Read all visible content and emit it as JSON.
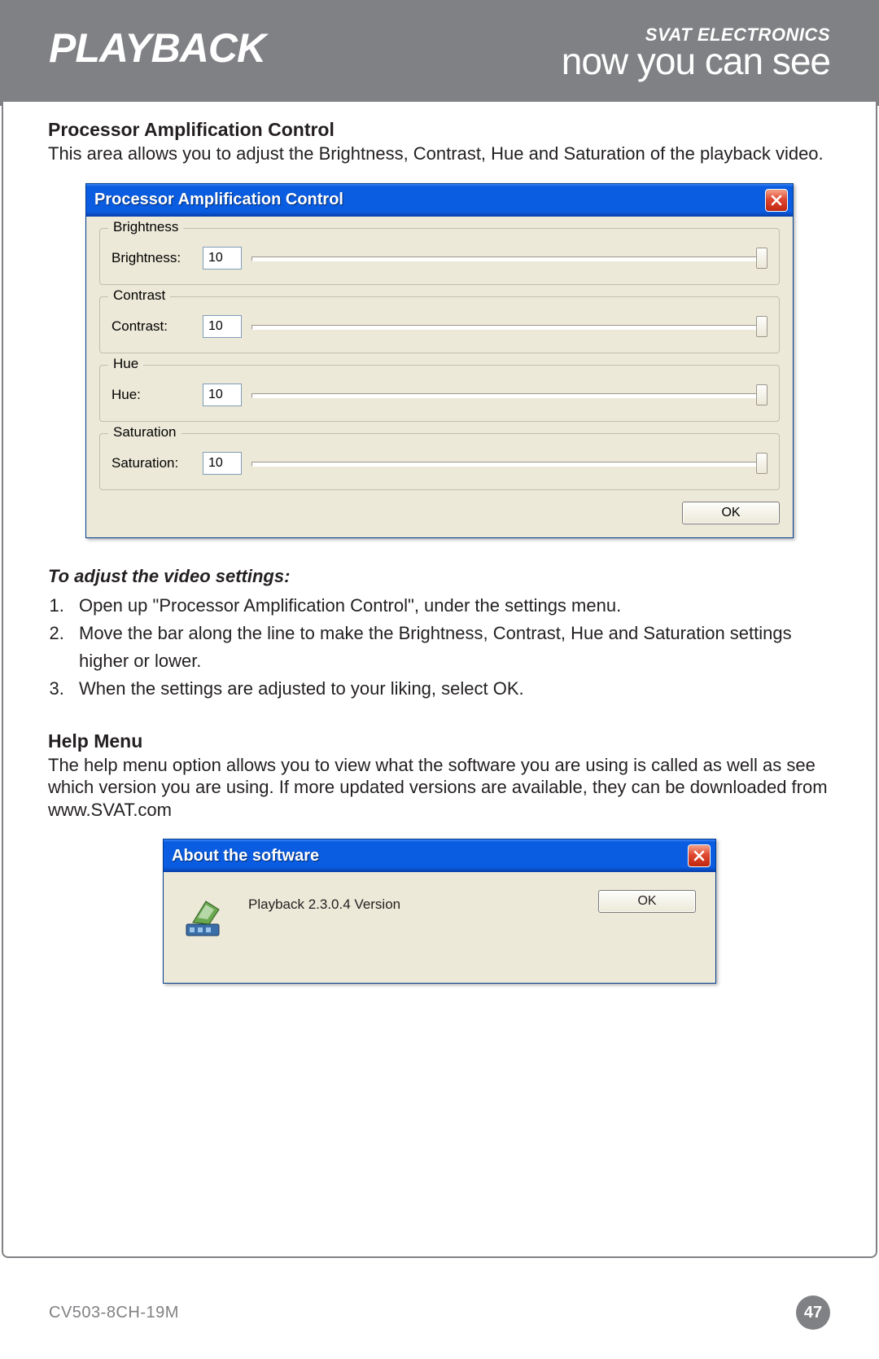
{
  "header": {
    "title": "PLAYBACK",
    "brand_small": "SVAT ELECTRONICS",
    "brand_big": "now you can see"
  },
  "section1": {
    "heading": "Processor Amplification Control",
    "text": "This area allows you to adjust the Brightness, Contrast, Hue and Saturation of the playback video."
  },
  "dialog": {
    "title": "Processor Amplification Control",
    "brightness": {
      "legend": "Brightness",
      "label": "Brightness:",
      "value": "10"
    },
    "contrast": {
      "legend": "Contrast",
      "label": "Contrast:",
      "value": "10"
    },
    "hue": {
      "legend": "Hue",
      "label": "Hue:",
      "value": "10"
    },
    "saturation": {
      "legend": "Saturation",
      "label": "Saturation:",
      "value": "10"
    },
    "ok": "OK"
  },
  "steps": {
    "heading": "To adjust the video settings:",
    "items": [
      "Open up \"Processor Amplification Control\", under the settings menu.",
      "Move the bar along the line to make the Brightness, Contrast, Hue and Saturation settings higher or lower.",
      "When the settings are adjusted to your liking, select OK."
    ]
  },
  "help": {
    "heading": "Help Menu",
    "text": "The help menu option allows you to view what the software you are using is called as well as see which version you are using. If more updated versions are available, they can be downloaded from www.SVAT.com"
  },
  "about": {
    "title": "About the software",
    "text": "Playback 2.3.0.4 Version",
    "ok": "OK"
  },
  "footer": {
    "model": "CV503-8CH-19M",
    "page": "47"
  }
}
